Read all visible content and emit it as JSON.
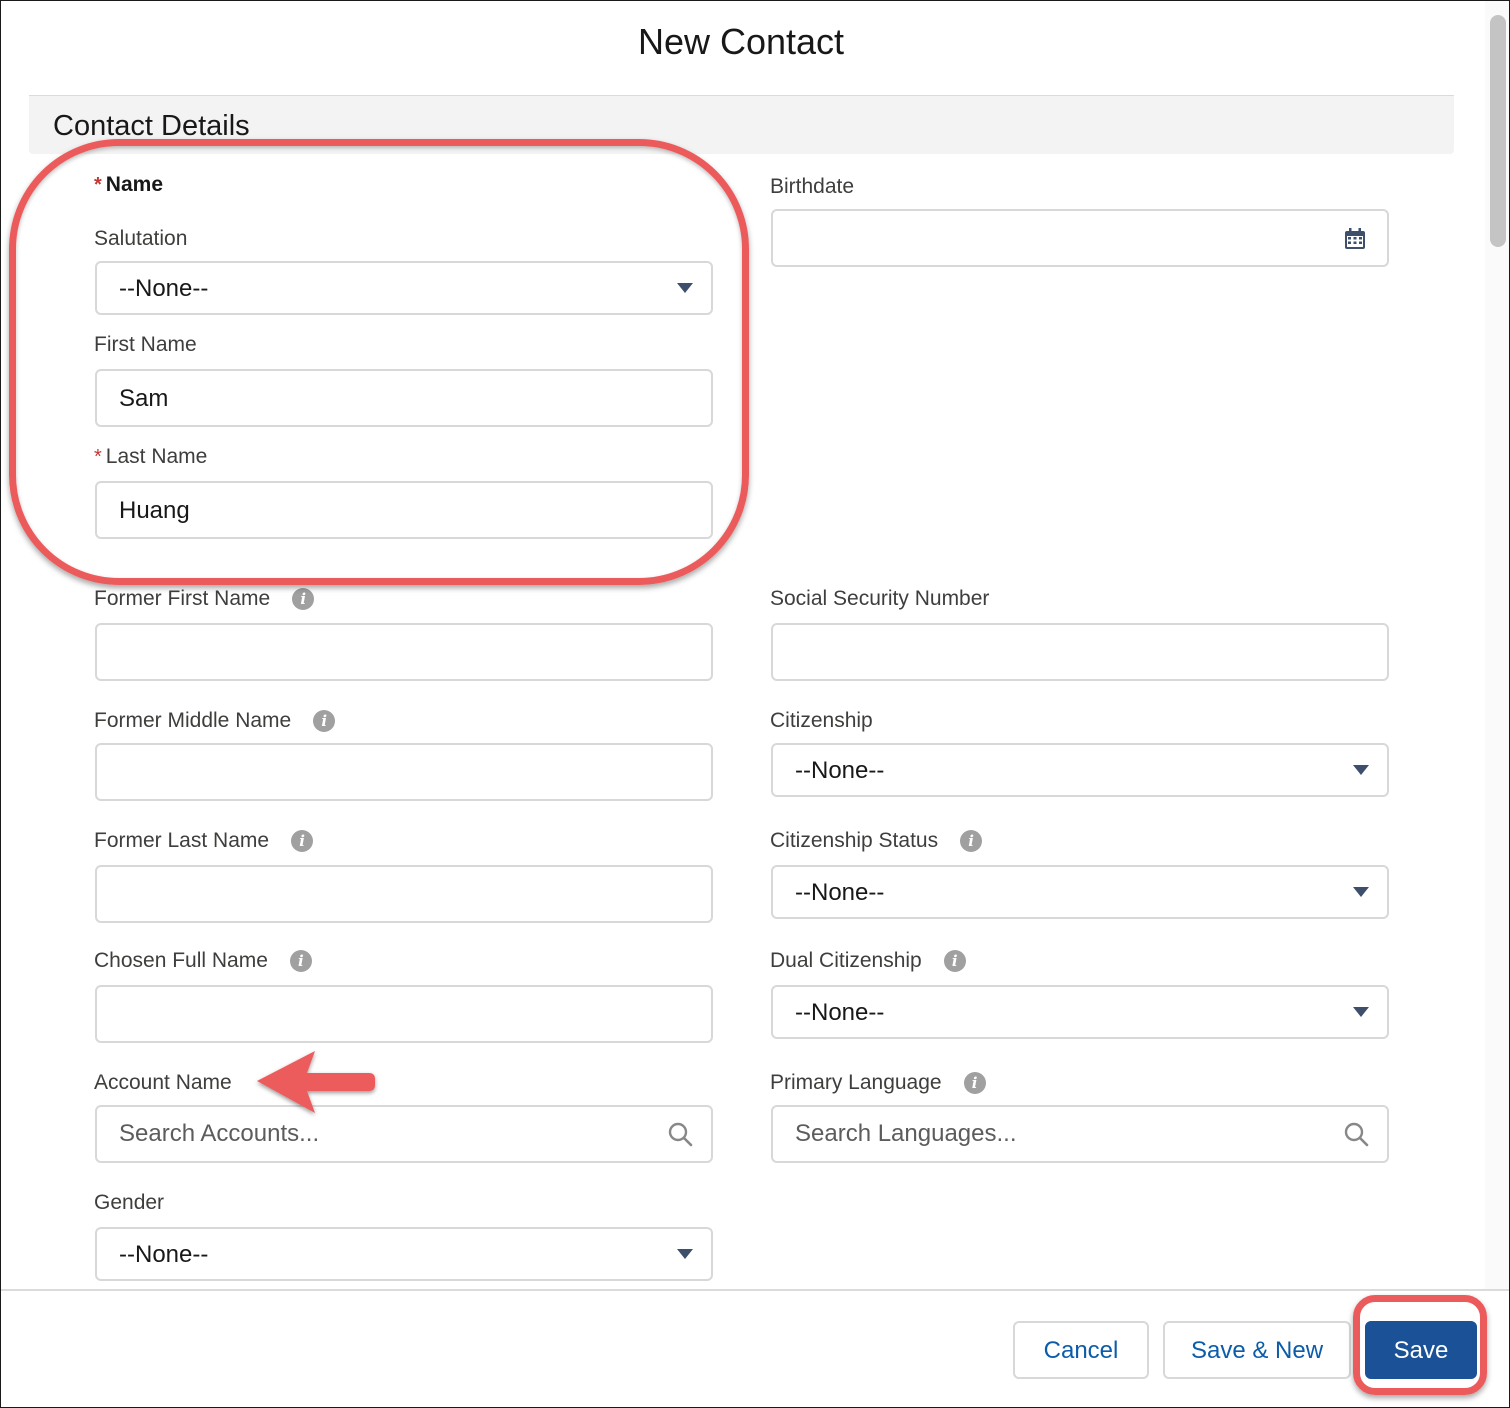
{
  "modal": {
    "title": "New Contact"
  },
  "section": {
    "title": "Contact Details"
  },
  "name_group": {
    "label": "Name",
    "required_mark": "*"
  },
  "fields": {
    "salutation": {
      "label": "Salutation",
      "value": "--None--"
    },
    "first_name": {
      "label": "First Name",
      "value": "Sam"
    },
    "last_name": {
      "label": "Last Name",
      "value": "Huang"
    },
    "former_first_name": {
      "label": "Former First Name",
      "value": ""
    },
    "former_middle_name": {
      "label": "Former Middle Name",
      "value": ""
    },
    "former_last_name": {
      "label": "Former Last Name",
      "value": ""
    },
    "chosen_full_name": {
      "label": "Chosen Full Name",
      "value": ""
    },
    "account_name": {
      "label": "Account Name",
      "placeholder": "Search Accounts..."
    },
    "gender": {
      "label": "Gender",
      "value": "--None--"
    },
    "birthdate": {
      "label": "Birthdate",
      "value": ""
    },
    "ssn": {
      "label": "Social Security Number",
      "value": ""
    },
    "citizenship": {
      "label": "Citizenship",
      "value": "--None--"
    },
    "citizenship_status": {
      "label": "Citizenship Status",
      "value": "--None--"
    },
    "dual_citizenship": {
      "label": "Dual Citizenship",
      "value": "--None--"
    },
    "primary_language": {
      "label": "Primary Language",
      "placeholder": "Search Languages..."
    }
  },
  "icons": {
    "info": "info-icon",
    "search": "search-icon",
    "calendar": "calendar-icon",
    "dropdown": "chevron-down-icon"
  },
  "footer": {
    "cancel": "Cancel",
    "save_new": "Save & New",
    "save": "Save"
  },
  "colors": {
    "accent": "#1b5297",
    "link": "#0b5cab",
    "annotation": "#ec5b5b",
    "required": "#c23934"
  }
}
